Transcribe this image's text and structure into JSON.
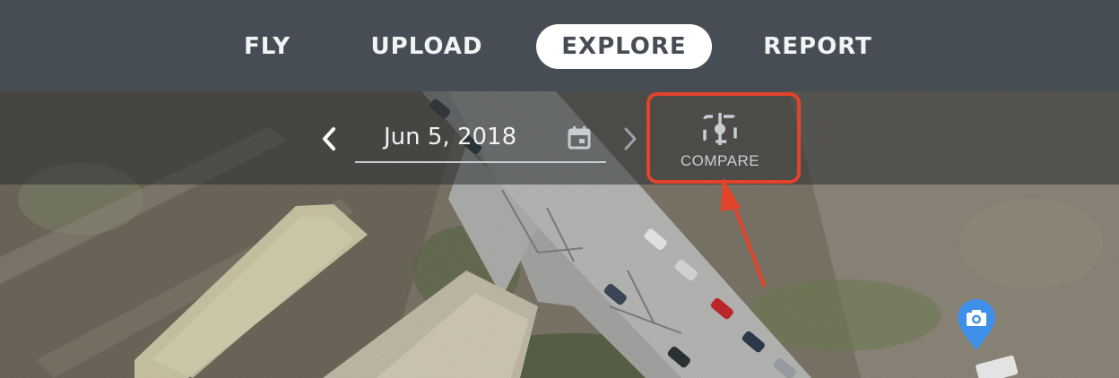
{
  "nav": {
    "items": [
      {
        "label": "FLY",
        "active": false
      },
      {
        "label": "UPLOAD",
        "active": false
      },
      {
        "label": "EXPLORE",
        "active": true
      },
      {
        "label": "REPORT",
        "active": false
      }
    ]
  },
  "date_toolbar": {
    "date": "Jun 5, 2018",
    "prev_icon": "chevron-left-icon",
    "next_icon": "chevron-right-icon",
    "calendar_icon": "calendar-icon",
    "compare_label": "COMPARE",
    "compare_icon": "compare-icon"
  },
  "map": {
    "marker_icon": "camera-icon",
    "marker_color": "#3d8fe8"
  },
  "colors": {
    "nav_bg": "#474d55",
    "active_pill": "#ffffff",
    "annotation": "#e2432a"
  }
}
